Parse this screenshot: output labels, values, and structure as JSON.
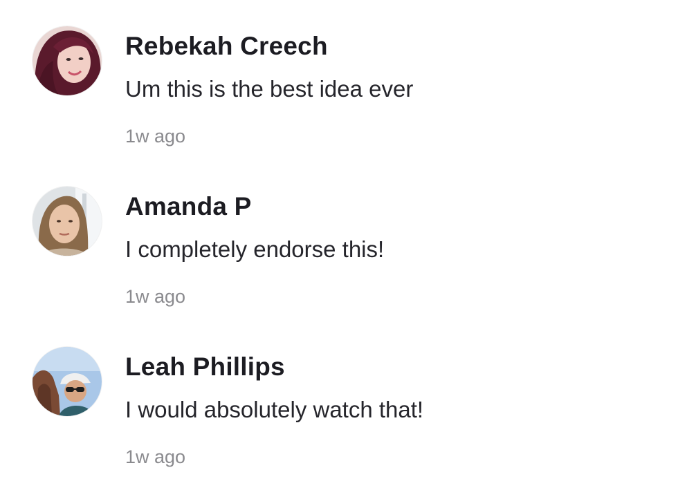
{
  "comments": [
    {
      "author": "Rebekah Creech",
      "text": "Um this is the best idea ever",
      "time": "1w ago",
      "avatar_icon": "avatar-photo"
    },
    {
      "author": "Amanda P",
      "text": "I completely endorse this!",
      "time": "1w ago",
      "avatar_icon": "avatar-photo"
    },
    {
      "author": "Leah Phillips",
      "text": "I would absolutely watch that!",
      "time": "1w ago",
      "avatar_icon": "avatar-photo"
    }
  ],
  "colors": {
    "author": "#1c1c22",
    "text": "#25252b",
    "timestamp": "#8a8a8e",
    "background": "#ffffff"
  }
}
